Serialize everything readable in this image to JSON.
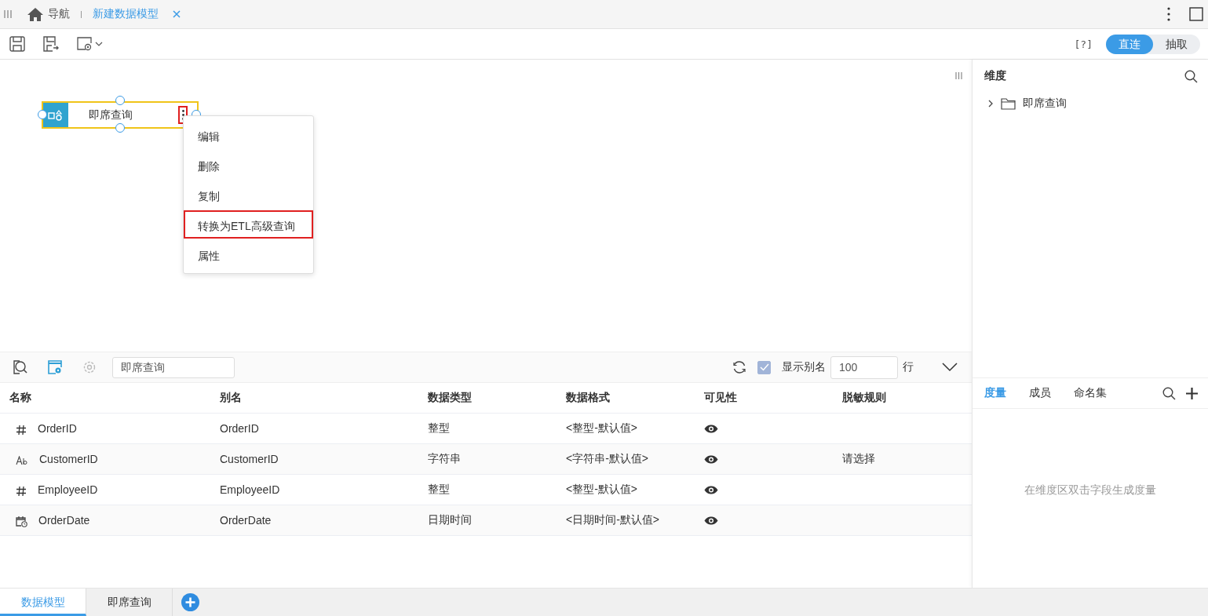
{
  "top_tabs": [
    {
      "label": "导航",
      "kind": "home",
      "selected": false
    },
    {
      "label": "新建数据模型",
      "kind": "doc",
      "selected": true
    }
  ],
  "toolbar": {
    "help": "[?]",
    "modes": [
      {
        "label": "直连",
        "selected": true
      },
      {
        "label": "抽取",
        "selected": false
      }
    ]
  },
  "canvas": {
    "node": {
      "label": "即席查询",
      "menu_button_highlighted": true
    },
    "menu": [
      {
        "label": "编辑",
        "highlighted": false
      },
      {
        "label": "删除",
        "highlighted": false
      },
      {
        "label": "复制",
        "highlighted": false
      },
      {
        "label": "转换为ETL高级查询",
        "highlighted": true
      },
      {
        "label": "属性",
        "highlighted": false
      }
    ]
  },
  "grid": {
    "source": "即席查询",
    "show_alias": {
      "label": "显示别名",
      "checked": true
    },
    "row_limit": "100",
    "row_unit": "行",
    "columns": [
      "名称",
      "别名",
      "数据类型",
      "数据格式",
      "可见性",
      "脱敏规则"
    ],
    "rows": [
      {
        "kind": "number",
        "name": "OrderID",
        "alias": "OrderID",
        "type": "整型",
        "format": "<整型-默认值>",
        "visible": true
      },
      {
        "kind": "string",
        "name": "CustomerID",
        "alias": "CustomerID",
        "type": "字符串",
        "format": "<字符串-默认值>",
        "visible": true,
        "masking": "请选择"
      },
      {
        "kind": "number",
        "name": "EmployeeID",
        "alias": "EmployeeID",
        "type": "整型",
        "format": "<整型-默认值>",
        "visible": true
      },
      {
        "kind": "datetime",
        "name": "OrderDate",
        "alias": "OrderDate",
        "type": "日期时间",
        "format": "<日期时间-默认值>",
        "visible": true
      }
    ]
  },
  "dimensions": {
    "title": "维度",
    "items": [
      {
        "label": "即席查询",
        "expanded": false
      }
    ]
  },
  "measures": {
    "tabs": [
      {
        "label": "度量",
        "selected": true
      },
      {
        "label": "成员",
        "selected": false
      },
      {
        "label": "命名集",
        "selected": false
      }
    ],
    "empty_text": "在维度区双击字段生成度量"
  },
  "bottom_tabs": [
    {
      "label": "数据模型",
      "selected": true
    },
    {
      "label": "即席查询",
      "selected": false
    }
  ]
}
